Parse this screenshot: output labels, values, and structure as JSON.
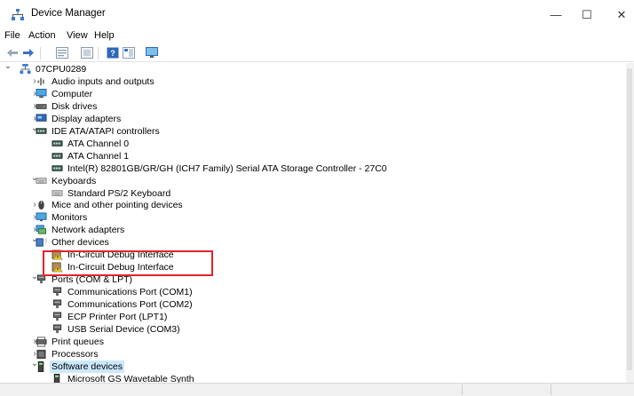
{
  "window": {
    "title": "Device Manager",
    "controls": {
      "minimize": "—",
      "maximize": "☐",
      "close": "✕"
    }
  },
  "menu": [
    "File",
    "Action",
    "View",
    "Help"
  ],
  "toolbar_icons": [
    "back-arrow-icon",
    "forward-arrow-icon",
    "properties-icon",
    "list-icon",
    "help-icon",
    "view-icon",
    "monitor-icon"
  ],
  "tree": [
    {
      "depth": 0,
      "expander": "open",
      "icon": "computer-root-icon",
      "label": "07CPU0289"
    },
    {
      "depth": 1,
      "expander": "closed",
      "icon": "audio-icon",
      "label": "Audio inputs and outputs"
    },
    {
      "depth": 1,
      "expander": "closed",
      "icon": "computer-icon",
      "label": "Computer"
    },
    {
      "depth": 1,
      "expander": "closed",
      "icon": "disk-icon",
      "label": "Disk drives"
    },
    {
      "depth": 1,
      "expander": "closed",
      "icon": "display-icon",
      "label": "Display adapters"
    },
    {
      "depth": 1,
      "expander": "open",
      "icon": "ide-icon",
      "label": "IDE ATA/ATAPI controllers"
    },
    {
      "depth": 2,
      "expander": "none",
      "icon": "ide-icon",
      "label": "ATA Channel 0"
    },
    {
      "depth": 2,
      "expander": "none",
      "icon": "ide-icon",
      "label": "ATA Channel 1"
    },
    {
      "depth": 2,
      "expander": "none",
      "icon": "ide-icon",
      "label": "Intel(R) 82801GB/GR/GH (ICH7 Family) Serial ATA Storage Controller - 27C0"
    },
    {
      "depth": 1,
      "expander": "open",
      "icon": "keyboard-icon",
      "label": "Keyboards"
    },
    {
      "depth": 2,
      "expander": "none",
      "icon": "keyboard-icon",
      "label": "Standard PS/2 Keyboard"
    },
    {
      "depth": 1,
      "expander": "closed",
      "icon": "mouse-icon",
      "label": "Mice and other pointing devices"
    },
    {
      "depth": 1,
      "expander": "closed",
      "icon": "monitor-icon",
      "label": "Monitors"
    },
    {
      "depth": 1,
      "expander": "closed",
      "icon": "network-icon",
      "label": "Network adapters"
    },
    {
      "depth": 1,
      "expander": "open",
      "icon": "other-devices-icon",
      "label": "Other devices"
    },
    {
      "depth": 2,
      "expander": "none",
      "icon": "warning-device-icon",
      "label": "In-Circuit Debug Interface"
    },
    {
      "depth": 2,
      "expander": "none",
      "icon": "warning-device-icon",
      "label": "In-Circuit Debug Interface"
    },
    {
      "depth": 1,
      "expander": "open",
      "icon": "port-icon",
      "label": "Ports (COM & LPT)"
    },
    {
      "depth": 2,
      "expander": "none",
      "icon": "port-icon",
      "label": "Communications Port (COM1)"
    },
    {
      "depth": 2,
      "expander": "none",
      "icon": "port-icon",
      "label": "Communications Port (COM2)"
    },
    {
      "depth": 2,
      "expander": "none",
      "icon": "port-icon",
      "label": "ECP Printer Port (LPT1)"
    },
    {
      "depth": 2,
      "expander": "none",
      "icon": "port-icon",
      "label": "USB Serial Device (COM3)"
    },
    {
      "depth": 1,
      "expander": "closed",
      "icon": "printer-icon",
      "label": "Print queues"
    },
    {
      "depth": 1,
      "expander": "closed",
      "icon": "processor-icon",
      "label": "Processors"
    },
    {
      "depth": 1,
      "expander": "open",
      "icon": "software-device-icon",
      "label": "Software devices",
      "selected": true
    },
    {
      "depth": 2,
      "expander": "none",
      "icon": "software-device-icon",
      "label": "Microsoft GS Wavetable Synth"
    }
  ],
  "colors": {
    "highlight": "#e2232a",
    "selection": "#cce8ff"
  }
}
